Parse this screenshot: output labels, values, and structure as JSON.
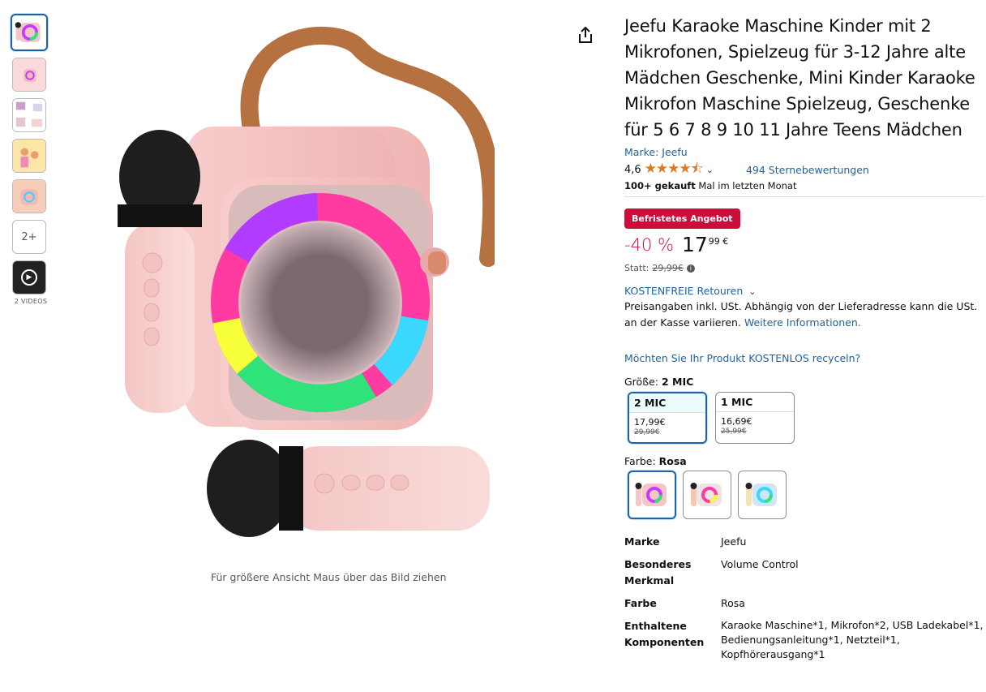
{
  "thumbnails": {
    "more_label": "2+",
    "videos_label": "2 VIDEOS"
  },
  "gallery": {
    "zoom_hint": "Für größere Ansicht Maus über das Bild ziehen"
  },
  "product": {
    "title": "Jeefu Karaoke Maschine Kinder mit 2 Mikrofonen, Spielzeug für 3-12 Jahre alte Mädchen Geschenke, Mini Kinder Karaoke Mikrofon Maschine Spielzeug, Geschenke für 5 6 7 8 9 10 11 Jahre Teens Mädchen",
    "brand_link": "Marke: Jeefu",
    "rating": "4,6",
    "stars": "★★★★⯪",
    "rating_count": "494 Sternebewertungen",
    "bought_bold": "100+ gekauft",
    "bought_rest": " Mal im letzten Monat"
  },
  "pricing": {
    "deal_badge": "Befristetes Angebot",
    "discount": "-40 %",
    "price_whole": "17",
    "price_frac": "99 €",
    "statt_label": "Statt:",
    "statt_price": "29,99€",
    "returns": "KOSTENFREIE Retouren",
    "note_text": "Preisangaben inkl. USt. Abhängig von der Lieferadresse kann die USt. an der Kasse variieren. ",
    "note_link": "Weitere Informationen.",
    "recycle": "Möchten Sie Ihr Produkt KOSTENLOS recyceln?"
  },
  "size": {
    "label": "Größe: ",
    "selected": "2 MIC",
    "options": [
      {
        "name": "2 MIC",
        "price": "17,99€",
        "old": "29,99€"
      },
      {
        "name": "1 MIC",
        "price": "16,69€",
        "old": "25,99€"
      }
    ]
  },
  "color": {
    "label": "Farbe: ",
    "selected": "Rosa"
  },
  "specs": [
    {
      "k": "Marke",
      "v": "Jeefu"
    },
    {
      "k": "Besonderes Merkmal",
      "v": "Volume Control"
    },
    {
      "k": "Farbe",
      "v": "Rosa"
    },
    {
      "k": "Enthaltene Komponenten",
      "v": "Karaoke Maschine*1, Mikrofon*2, USB Ladekabel*1, Bedienungsanleitung*1, Netzteil*1, Kopfhörerausgang*1"
    }
  ],
  "colors": {
    "accent": "#2162a1",
    "deal": "#cc0c39",
    "star": "#de7921"
  }
}
